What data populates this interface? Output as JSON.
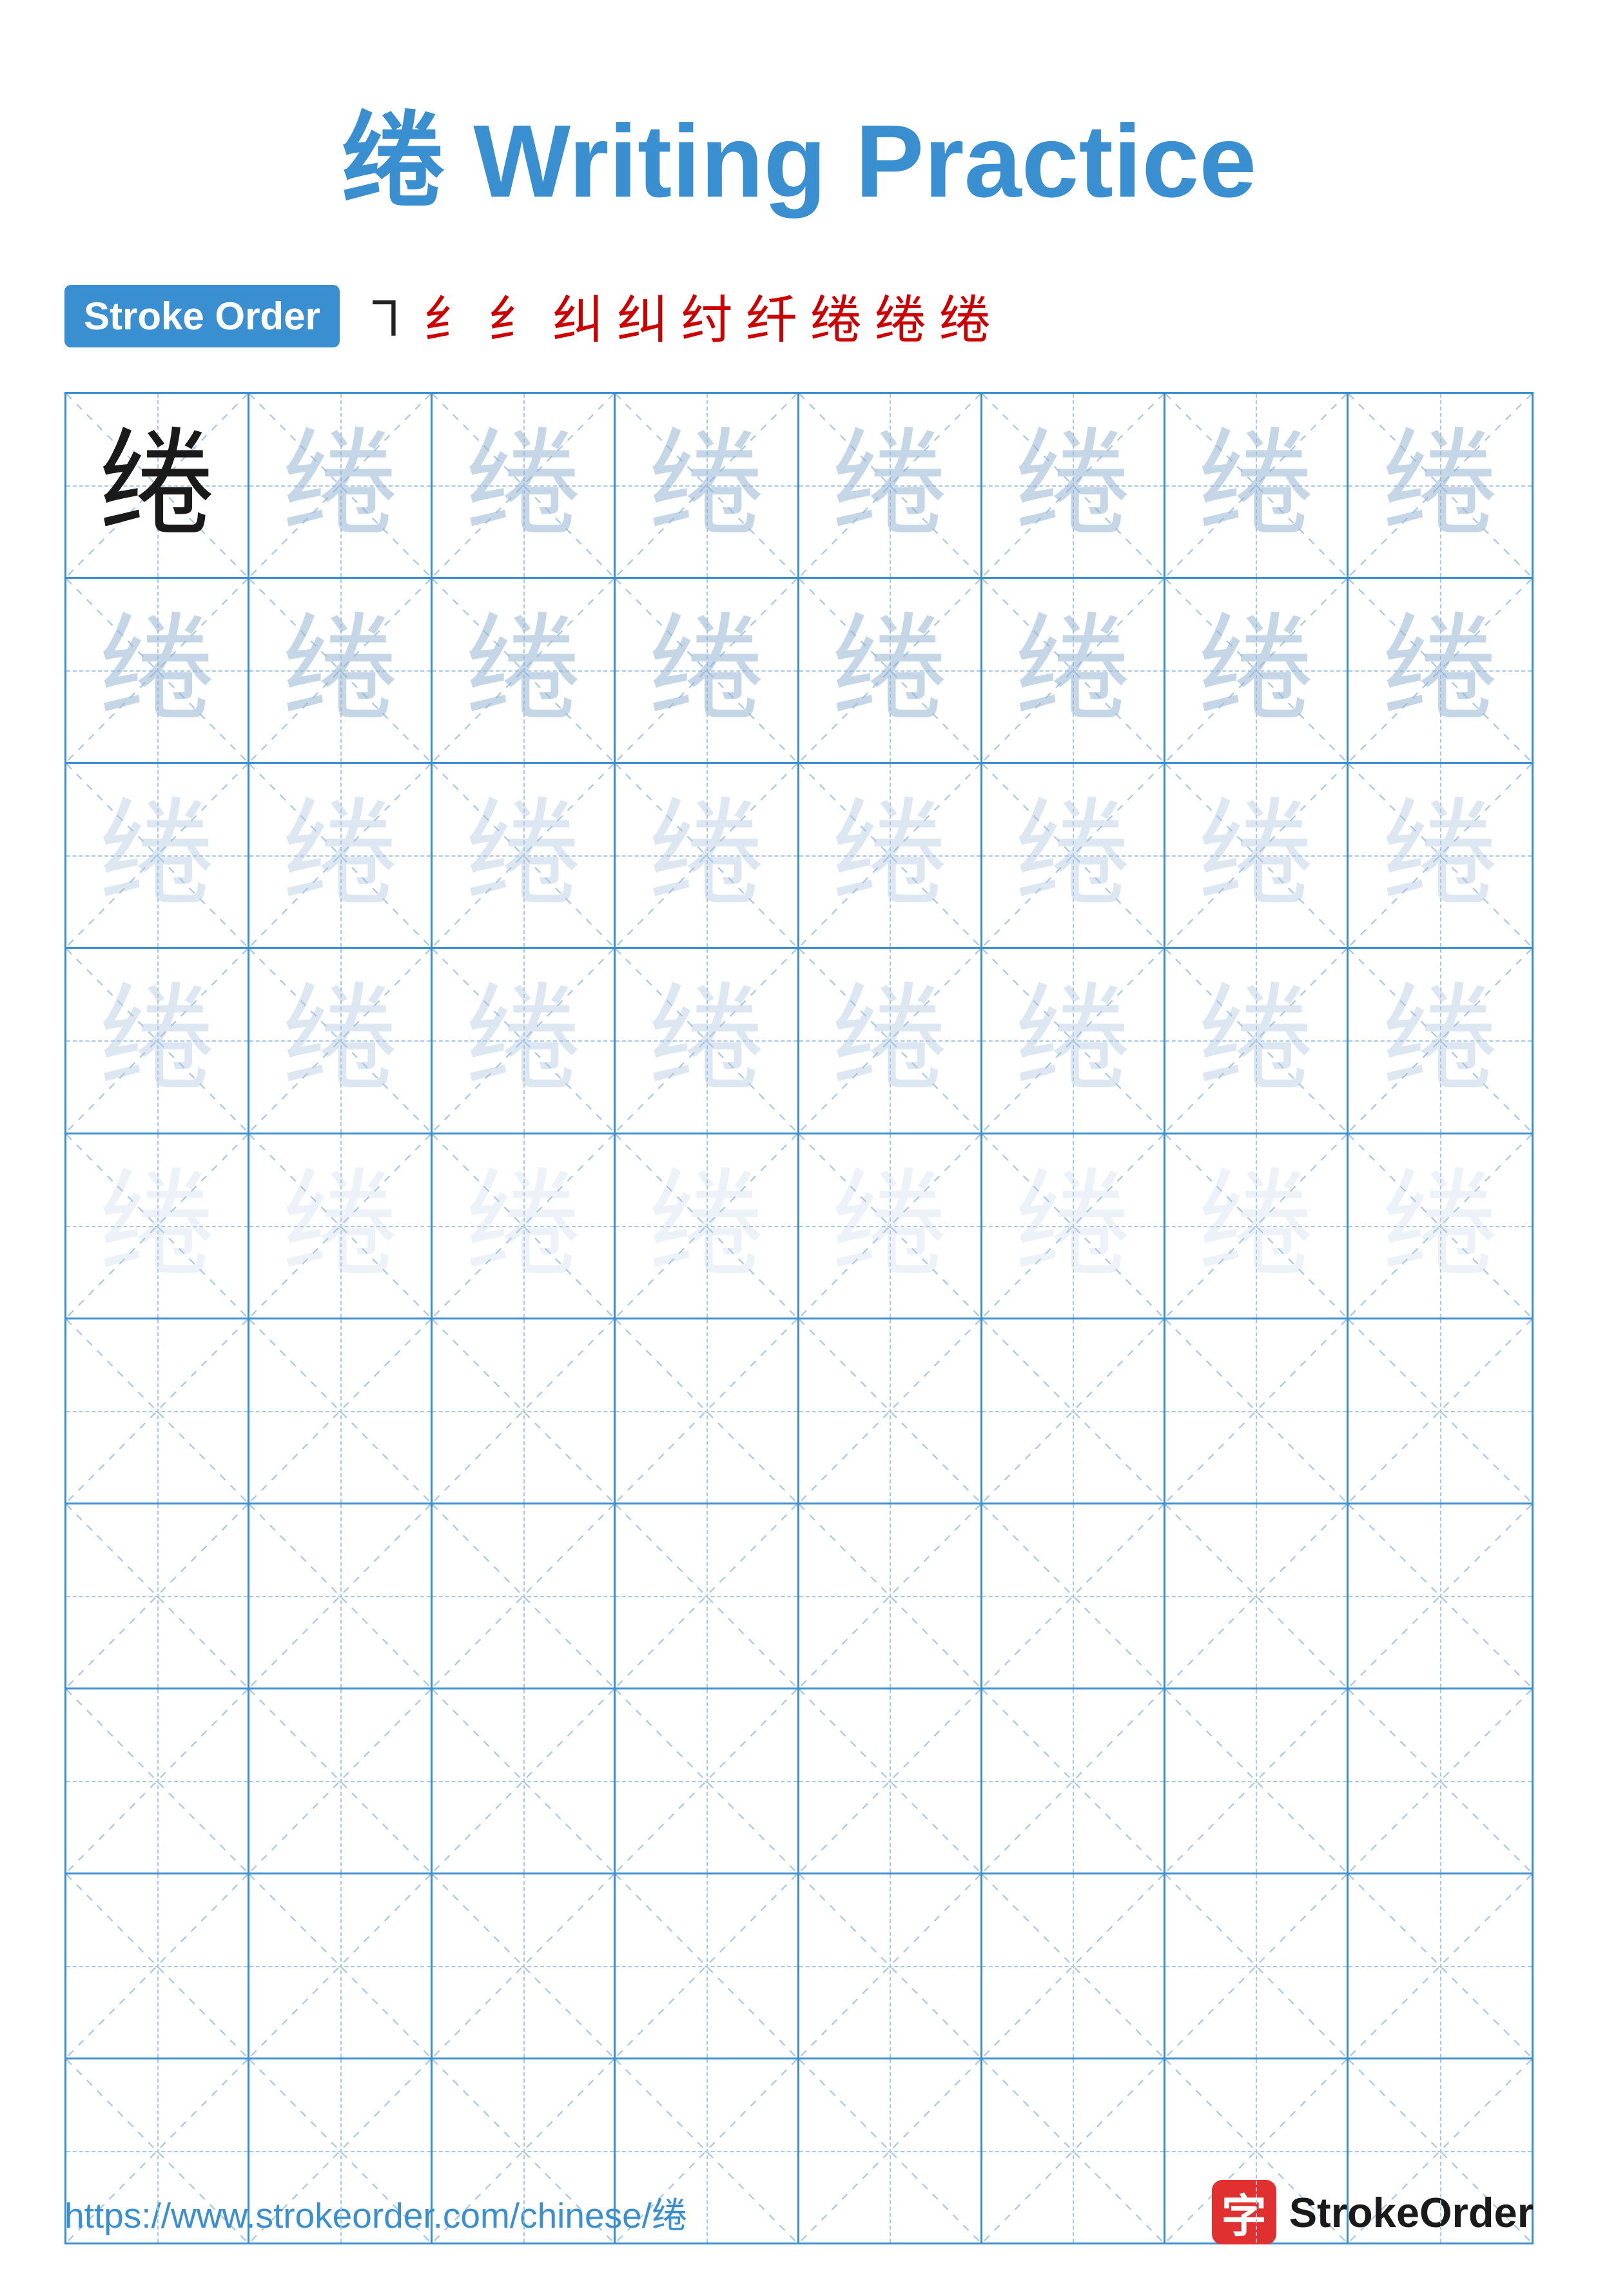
{
  "title": {
    "char": "绻",
    "label": " Writing Practice",
    "full": "绻 Writing Practice"
  },
  "stroke_order": {
    "badge_label": "Stroke Order",
    "strokes": [
      "㇕",
      "纟",
      "纟",
      "纟",
      "纟",
      "纟",
      "纟",
      "绻",
      "绻",
      "绻"
    ]
  },
  "grid": {
    "rows": 10,
    "cols": 8,
    "char": "绻"
  },
  "footer": {
    "url": "https://www.strokeorder.com/chinese/绻",
    "logo_char": "字",
    "logo_text": "StrokeOrder"
  }
}
